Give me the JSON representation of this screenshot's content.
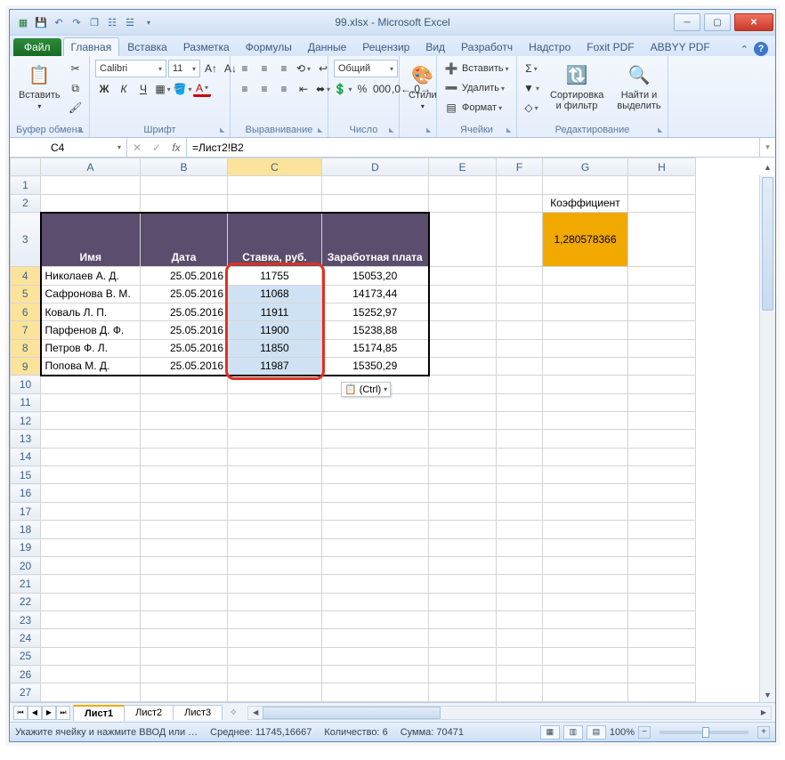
{
  "window": {
    "title": "99.xlsx - Microsoft Excel"
  },
  "qat": {
    "save": "💾",
    "undo": "↶",
    "redo": "↷"
  },
  "ribbon": {
    "file": "Файл",
    "tabs": [
      "Главная",
      "Вставка",
      "Разметка",
      "Формулы",
      "Данные",
      "Рецензир",
      "Вид",
      "Разработч",
      "Надстро",
      "Foxit PDF",
      "ABBYY PDF"
    ],
    "active_tab": "Главная",
    "groups": {
      "clipboard": {
        "label": "Буфер обмена",
        "paste": "Вставить"
      },
      "font": {
        "label": "Шрифт",
        "name": "Calibri",
        "size": "11"
      },
      "align": {
        "label": "Выравнивание"
      },
      "number": {
        "label": "Число",
        "format": "Общий"
      },
      "styles": {
        "label": "",
        "btn": "Стили"
      },
      "cells": {
        "label": "Ячейки",
        "insert": "Вставить",
        "delete": "Удалить",
        "format": "Формат"
      },
      "editing": {
        "label": "Редактирование",
        "sort": "Сортировка и фильтр",
        "find": "Найти и выделить"
      }
    }
  },
  "formulabar": {
    "cellref": "C4",
    "formula": "=Лист2!B2",
    "fx": "fx"
  },
  "columns": [
    "A",
    "B",
    "C",
    "D",
    "E",
    "F",
    "G",
    "H"
  ],
  "table": {
    "g2": "Коэффициент",
    "g3": "1,280578366",
    "headers": [
      "Имя",
      "Дата",
      "Ставка, руб.",
      "Заработная плата"
    ],
    "rows": [
      {
        "n": "4",
        "name": "Николаев А. Д.",
        "date": "25.05.2016",
        "rate": "11755",
        "salary": "15053,20"
      },
      {
        "n": "5",
        "name": "Сафронова В. М.",
        "date": "25.05.2016",
        "rate": "11068",
        "salary": "14173,44"
      },
      {
        "n": "6",
        "name": "Коваль Л. П.",
        "date": "25.05.2016",
        "rate": "11911",
        "salary": "15252,97"
      },
      {
        "n": "7",
        "name": "Парфенов Д. Ф.",
        "date": "25.05.2016",
        "rate": "11900",
        "salary": "15238,88"
      },
      {
        "n": "8",
        "name": "Петров Ф. Л.",
        "date": "25.05.2016",
        "rate": "11850",
        "salary": "15174,85"
      },
      {
        "n": "9",
        "name": "Попова М. Д.",
        "date": "25.05.2016",
        "rate": "11987",
        "salary": "15350,29"
      }
    ]
  },
  "paste_popup": "(Ctrl)",
  "sheets": {
    "active": "Лист1",
    "others": [
      "Лист2",
      "Лист3"
    ]
  },
  "statusbar": {
    "mode": "Укажите ячейку и нажмите ВВОД или …",
    "avg_label": "Среднее:",
    "avg": "11745,16667",
    "count_label": "Количество:",
    "count": "6",
    "sum_label": "Сумма:",
    "sum": "70471",
    "zoom": "100%"
  }
}
